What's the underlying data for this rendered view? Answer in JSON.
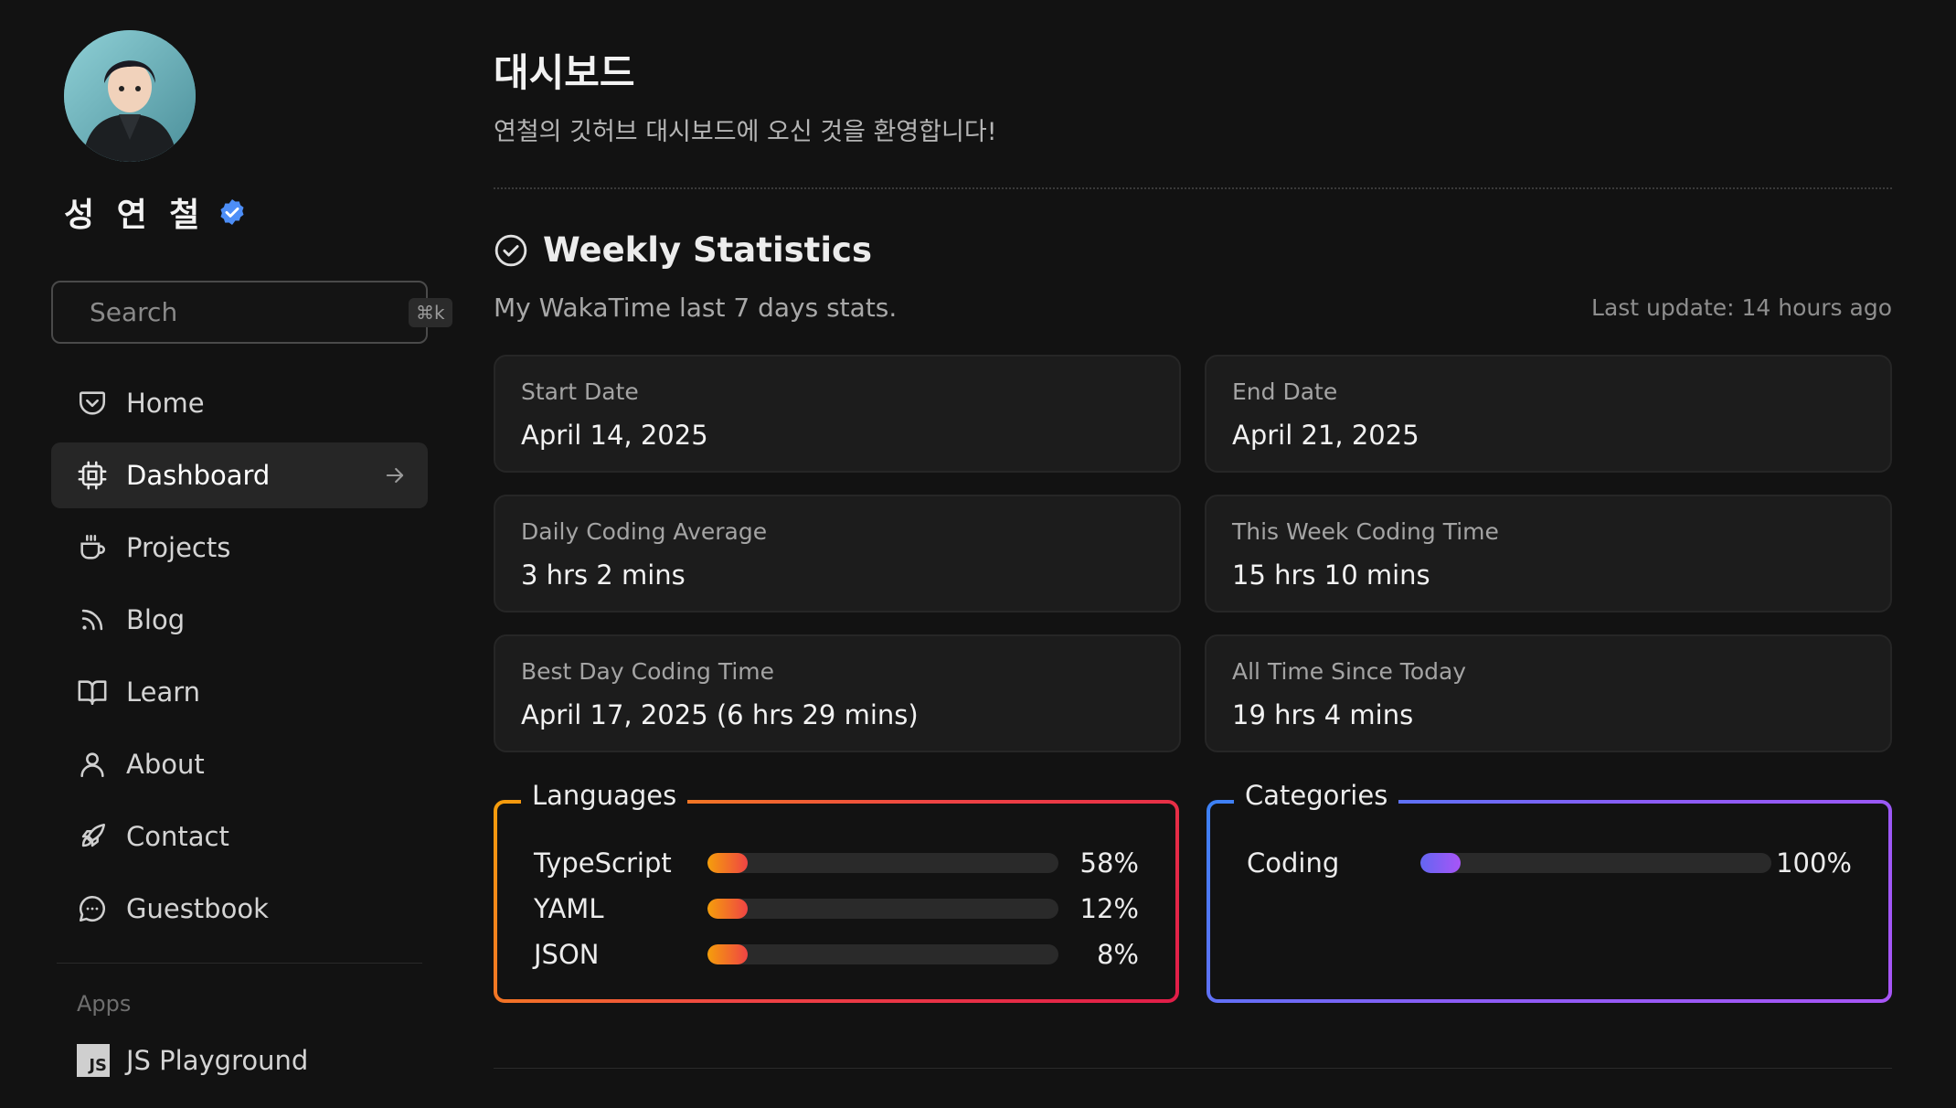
{
  "profile": {
    "name": "성 연 철"
  },
  "search": {
    "placeholder": "Search",
    "shortcut": "⌘k"
  },
  "nav": {
    "items": [
      {
        "label": "Home",
        "icon": "pocket-icon"
      },
      {
        "label": "Dashboard",
        "icon": "cpu-icon",
        "active": true
      },
      {
        "label": "Projects",
        "icon": "coffee-icon"
      },
      {
        "label": "Blog",
        "icon": "rss-icon"
      },
      {
        "label": "Learn",
        "icon": "book-icon"
      },
      {
        "label": "About",
        "icon": "user-icon"
      },
      {
        "label": "Contact",
        "icon": "rocket-icon"
      },
      {
        "label": "Guestbook",
        "icon": "chat-icon"
      }
    ]
  },
  "apps": {
    "label": "Apps",
    "items": [
      {
        "label": "JS Playground",
        "badge": "JS"
      }
    ]
  },
  "page": {
    "title": "대시보드",
    "subtitle": "연철의 깃허브 대시보드에 오신 것을 환영합니다!"
  },
  "weekly": {
    "title": "Weekly Statistics",
    "description": "My WakaTime last 7 days stats.",
    "last_update": "Last update: 14 hours ago",
    "cards": [
      {
        "label": "Start Date",
        "value": "April 14, 2025"
      },
      {
        "label": "End Date",
        "value": "April 21, 2025"
      },
      {
        "label": "Daily Coding Average",
        "value": "3 hrs 2 mins"
      },
      {
        "label": "This Week Coding Time",
        "value": "15 hrs 10 mins"
      },
      {
        "label": "Best Day Coding Time",
        "value": "April 17, 2025 (6 hrs 29 mins)"
      },
      {
        "label": "All Time Since Today",
        "value": "19 hrs 4 mins"
      }
    ]
  },
  "languages": {
    "title": "Languages",
    "items": [
      {
        "name": "TypeScript",
        "percent": "58%"
      },
      {
        "name": "YAML",
        "percent": "12%"
      },
      {
        "name": "JSON",
        "percent": "8%"
      }
    ]
  },
  "categories": {
    "title": "Categories",
    "items": [
      {
        "name": "Coding",
        "percent": "100%"
      }
    ]
  },
  "colors": {
    "background": "#121212",
    "accent_verified": "#3b82f6",
    "languages_gradient": [
      "#f59e0b",
      "#ef4444"
    ],
    "categories_gradient": [
      "#6366f1",
      "#a855f7"
    ]
  }
}
